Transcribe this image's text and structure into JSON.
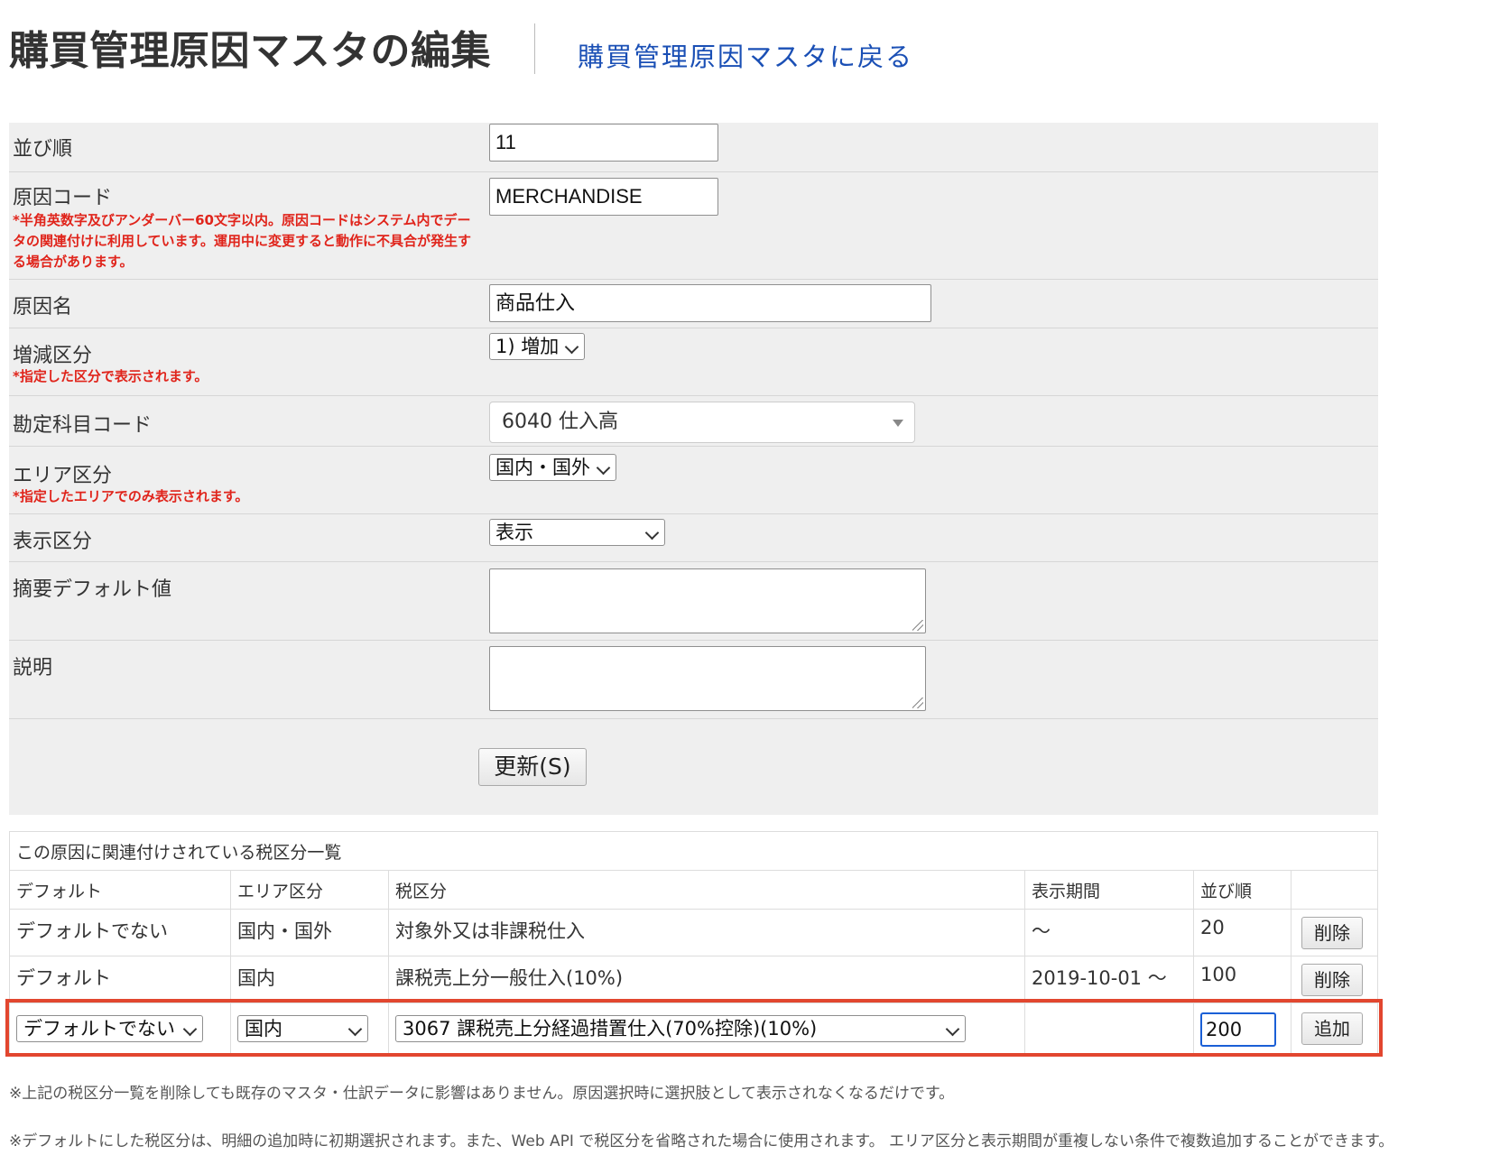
{
  "header": {
    "title": "購買管理原因マスタの編集",
    "back_link": "購買管理原因マスタに戻る"
  },
  "form": {
    "sort_order": {
      "label": "並び順",
      "value": "11"
    },
    "reason_code": {
      "label": "原因コード",
      "value": "MERCHANDISE",
      "note": "*半角英数字及びアンダーバー60文字以内。原因コードはシステム内でデータの関連付けに利用しています。運用中に変更すると動作に不具合が発生する場合があります。"
    },
    "reason_name": {
      "label": "原因名",
      "value": "商品仕入"
    },
    "change_type": {
      "label": "増減区分",
      "value": "1) 増加",
      "note": "*指定した区分で表示されます。"
    },
    "account_code": {
      "label": "勘定科目コード",
      "value": "6040 仕入高"
    },
    "area": {
      "label": "エリア区分",
      "value": "国内・国外",
      "note": "*指定したエリアでのみ表示されます。"
    },
    "display": {
      "label": "表示区分",
      "value": "表示"
    },
    "summary_default": {
      "label": "摘要デフォルト値",
      "value": ""
    },
    "description": {
      "label": "説明",
      "value": ""
    },
    "update_button": "更新(S)"
  },
  "tax_table": {
    "caption": "この原因に関連付けされている税区分一覧",
    "headers": [
      "デフォルト",
      "エリア区分",
      "税区分",
      "表示期間",
      "並び順",
      ""
    ],
    "rows": [
      {
        "default": "デフォルトでない",
        "area": "国内・国外",
        "tax": "対象外又は非課税仕入",
        "period": "〜",
        "order": "20",
        "action": "削除"
      },
      {
        "default": "デフォルト",
        "area": "国内",
        "tax": "課税売上分一般仕入(10%)",
        "period": "2019-10-01 〜",
        "order": "100",
        "action": "削除"
      }
    ],
    "new_row": {
      "default": "デフォルトでない",
      "area": "国内",
      "tax": "3067 課税売上分経過措置仕入(70%控除)(10%)",
      "order": "200",
      "action": "追加"
    }
  },
  "footnotes": [
    "※上記の税区分一覧を削除しても既存のマスタ・仕訳データに影響はありません。原因選択時に選択肢として表示されなくなるだけです。",
    "※デフォルトにした税区分は、明細の追加時に初期選択されます。また、Web API で税区分を省略された場合に使用されます。 エリア区分と表示期間が重複しない条件で複数追加することができます。"
  ],
  "colors": {
    "accent_link": "#1a4fb5",
    "note_red": "#e0241b",
    "highlight_border": "#e2462f"
  }
}
